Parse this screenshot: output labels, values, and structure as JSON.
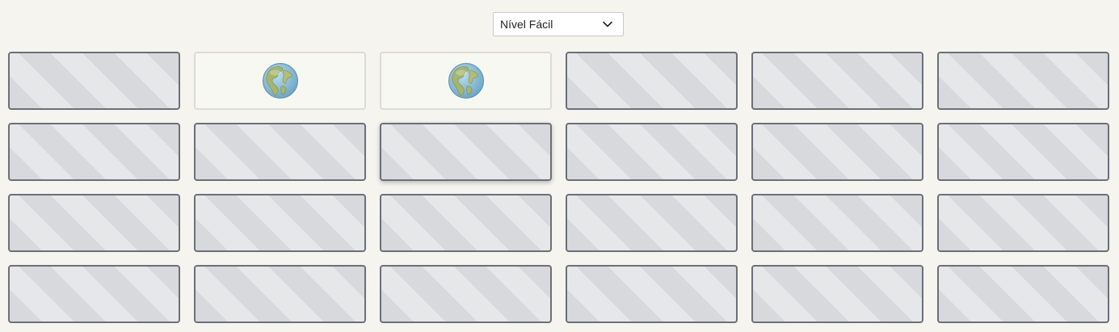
{
  "level_select": {
    "selected": "Nível Fácil",
    "icon": "chevron-down-icon"
  },
  "board": {
    "columns": 6,
    "rows": 4,
    "cards": [
      {
        "state": "hidden"
      },
      {
        "state": "revealed",
        "icon": "globe-americas-icon"
      },
      {
        "state": "revealed",
        "icon": "globe-americas-icon"
      },
      {
        "state": "hidden"
      },
      {
        "state": "hidden"
      },
      {
        "state": "hidden"
      },
      {
        "state": "hidden"
      },
      {
        "state": "hidden"
      },
      {
        "state": "hidden",
        "hovered": true
      },
      {
        "state": "hidden"
      },
      {
        "state": "hidden"
      },
      {
        "state": "hidden"
      },
      {
        "state": "hidden"
      },
      {
        "state": "hidden"
      },
      {
        "state": "hidden"
      },
      {
        "state": "hidden"
      },
      {
        "state": "hidden"
      },
      {
        "state": "hidden"
      },
      {
        "state": "hidden"
      },
      {
        "state": "hidden"
      },
      {
        "state": "hidden"
      },
      {
        "state": "hidden"
      },
      {
        "state": "hidden"
      },
      {
        "state": "hidden"
      }
    ]
  },
  "colors": {
    "background": "#f5f4ef",
    "card_border": "#6b7078",
    "card_stripe_dark": "#d7d9dc",
    "card_stripe_light": "#e6e7e9",
    "revealed_bg": "#f8f8f3"
  }
}
